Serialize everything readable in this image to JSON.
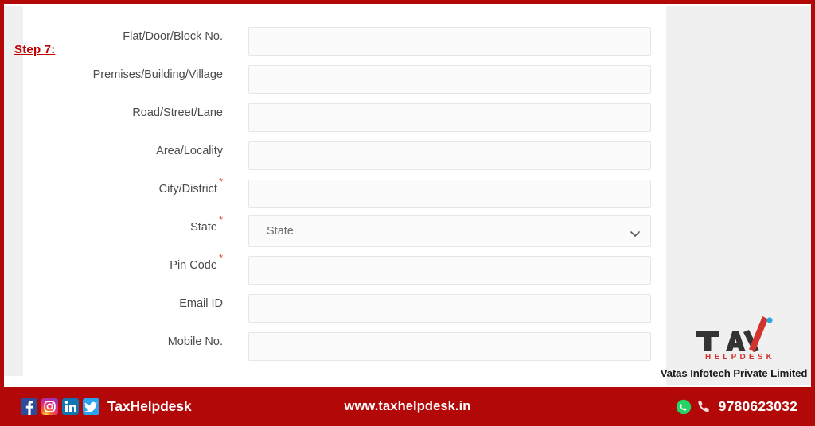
{
  "page": {
    "step_marker": "Step 7:",
    "accent_red": "#b30808",
    "step_red": "#c00000"
  },
  "form": {
    "fields": [
      {
        "label": "Flat/Door/Block No.",
        "required": false,
        "type": "text",
        "value": "",
        "placeholder": ""
      },
      {
        "label": "Premises/Building/Village",
        "required": false,
        "type": "text",
        "value": "",
        "placeholder": ""
      },
      {
        "label": "Road/Street/Lane",
        "required": false,
        "type": "text",
        "value": "",
        "placeholder": ""
      },
      {
        "label": "Area/Locality",
        "required": false,
        "type": "text",
        "value": "",
        "placeholder": ""
      },
      {
        "label": "City/District",
        "required": true,
        "type": "text",
        "value": "",
        "placeholder": ""
      },
      {
        "label": "State",
        "required": true,
        "type": "select",
        "value": "State",
        "placeholder": "State"
      },
      {
        "label": "Pin Code",
        "required": true,
        "type": "text",
        "value": "",
        "placeholder": ""
      },
      {
        "label": "Email ID",
        "required": false,
        "type": "text",
        "value": "",
        "placeholder": ""
      },
      {
        "label": "Mobile No.",
        "required": false,
        "type": "text",
        "value": "",
        "placeholder": ""
      }
    ],
    "required_marker": "*",
    "state_select": {
      "selected": "State",
      "options": [
        "State"
      ]
    }
  },
  "brand": {
    "logo_text_dark": "TA",
    "logo_text_accent": "X",
    "logo_tagline": "HELPDESK",
    "company": "Vatas Infotech Private Limited",
    "logo_dark_color": "#333333",
    "logo_accent_color": "#d2332e",
    "logo_dot_color": "#29a8df"
  },
  "footer": {
    "social_handle": "TaxHelpdesk",
    "website": "www.taxhelpdesk.in",
    "phone": "9780623032",
    "social_icons": [
      {
        "name": "facebook-icon",
        "glyph": "f"
      },
      {
        "name": "instagram-icon",
        "glyph": ""
      },
      {
        "name": "linkedin-icon",
        "glyph": "in"
      },
      {
        "name": "twitter-icon",
        "glyph": ""
      }
    ],
    "contact_icons": [
      {
        "name": "whatsapp-icon"
      },
      {
        "name": "phone-icon"
      }
    ]
  }
}
